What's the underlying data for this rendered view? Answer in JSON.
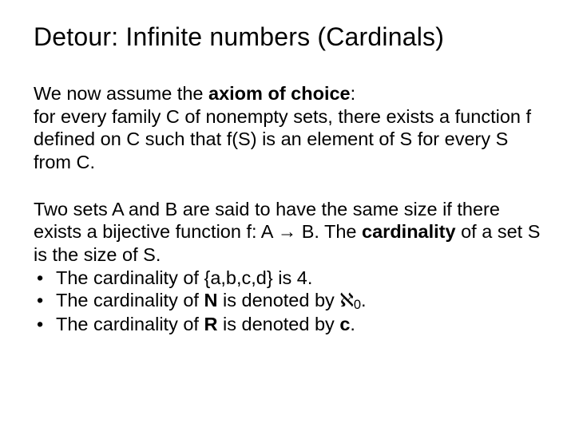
{
  "title": "Detour: Infinite numbers (Cardinals)",
  "p1": {
    "lead": "We now assume the ",
    "bold": "axiom of choice",
    "after": ":",
    "rest": "for every family C of nonempty sets, there exists a function f defined on C such that f(S) is an element of S for every S from C."
  },
  "p2": {
    "l1": "Two sets A and B are said to have the same size if there exists a bijective function f: A → B. The ",
    "card": "cardinality",
    "l2": " of a set S is the size of S."
  },
  "bullets": {
    "b1": "The cardinality of {a,b,c,d} is 4.",
    "b2a": "The cardinality of ",
    "b2N": "N",
    "b2b": " is denoted by ",
    "b2aleph": "ℵ",
    "b2sub": "0",
    "b2end": ".",
    "b3a": "The cardinality of ",
    "b3R": "R",
    "b3b": " is denoted by ",
    "b3c": "c",
    "b3end": "."
  }
}
